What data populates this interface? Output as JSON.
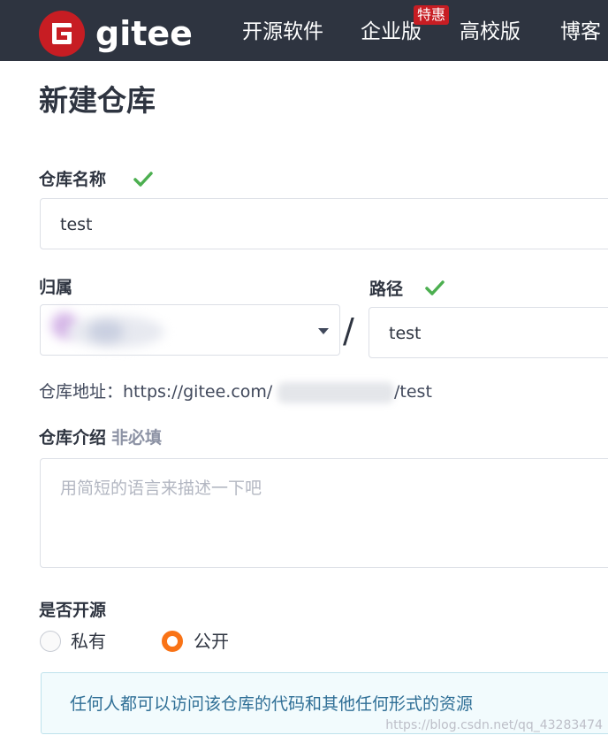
{
  "header": {
    "logo_text": "gitee",
    "nav": [
      {
        "label": "开源软件"
      },
      {
        "label": "企业版"
      },
      {
        "label": "高校版"
      },
      {
        "label": "博客"
      }
    ],
    "badge": "特惠",
    "brand_color": "#c71d23",
    "bg_color": "#2e3440"
  },
  "page": {
    "title": "新建仓库"
  },
  "form": {
    "repo_name_label": "仓库名称",
    "repo_name_value": "test",
    "owner_label": "归属",
    "path_label": "路径",
    "path_value": "test",
    "slash": "/",
    "repo_url_prefix": "仓库地址：https://gitee.com/",
    "repo_url_suffix": "/test",
    "desc_label": "仓库介绍",
    "desc_optional": "非必填",
    "desc_placeholder": "用简短的语言来描述一下吧",
    "visibility_label": "是否开源",
    "options": [
      {
        "label": "私有",
        "selected": false
      },
      {
        "label": "公开",
        "selected": true
      }
    ],
    "notice": "任何人都可以访问该仓库的代码和其他任何形式的资源",
    "check_color": "#4caf50",
    "radio_color": "#f97316"
  },
  "watermark": "https://blog.csdn.net/qq_43283474"
}
